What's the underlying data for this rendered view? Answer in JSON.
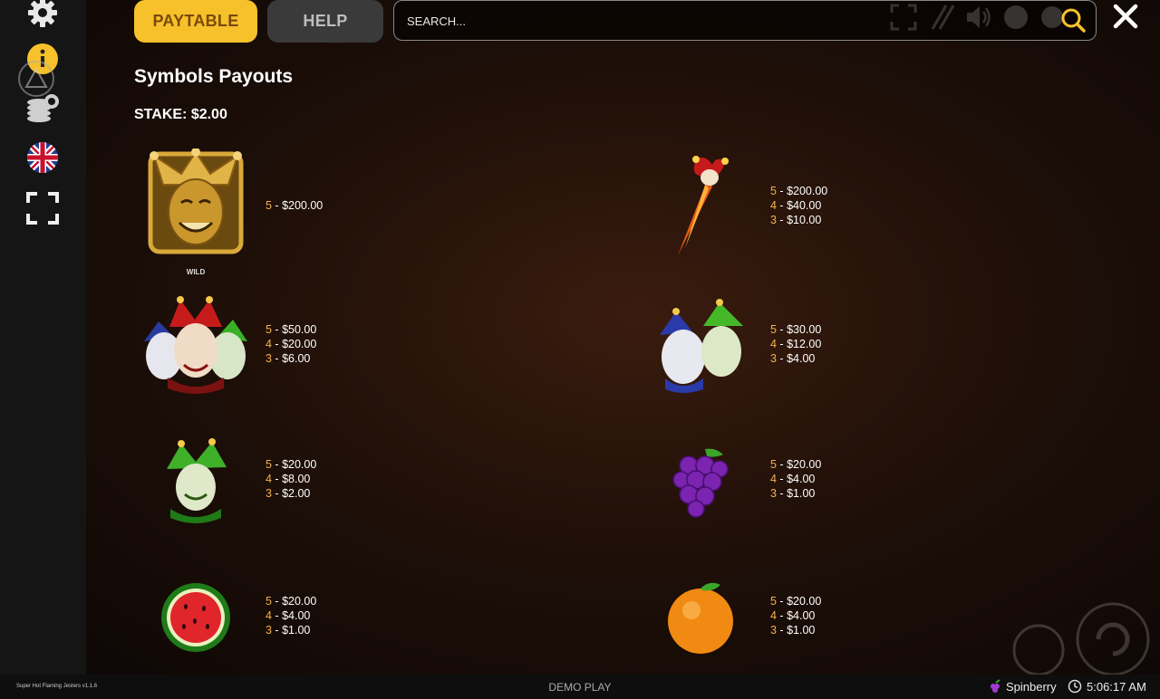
{
  "tabs": {
    "paytable": "PAYTABLE",
    "help": "HELP"
  },
  "search": {
    "placeholder": "SEARCH..."
  },
  "heading": "Symbols Payouts",
  "stake": "STAKE: $2.00",
  "sidebar_icons": [
    "gear-icon",
    "info-icon",
    "coins-icon",
    "uk-flag-icon",
    "fullscreen-icon"
  ],
  "symbols": [
    {
      "name": "wild-jester-gold",
      "label": "WILD",
      "pays": [
        {
          "n": "5",
          "v": "$200.00"
        }
      ]
    },
    {
      "name": "flaming-scepter",
      "pays": [
        {
          "n": "5",
          "v": "$200.00"
        },
        {
          "n": "4",
          "v": "$40.00"
        },
        {
          "n": "3",
          "v": "$10.00"
        }
      ]
    },
    {
      "name": "three-jesters",
      "pays": [
        {
          "n": "5",
          "v": "$50.00"
        },
        {
          "n": "4",
          "v": "$20.00"
        },
        {
          "n": "3",
          "v": "$6.00"
        }
      ]
    },
    {
      "name": "two-jesters",
      "pays": [
        {
          "n": "5",
          "v": "$30.00"
        },
        {
          "n": "4",
          "v": "$12.00"
        },
        {
          "n": "3",
          "v": "$4.00"
        }
      ]
    },
    {
      "name": "green-jester",
      "pays": [
        {
          "n": "5",
          "v": "$20.00"
        },
        {
          "n": "4",
          "v": "$8.00"
        },
        {
          "n": "3",
          "v": "$2.00"
        }
      ]
    },
    {
      "name": "grapes",
      "pays": [
        {
          "n": "5",
          "v": "$20.00"
        },
        {
          "n": "4",
          "v": "$4.00"
        },
        {
          "n": "3",
          "v": "$1.00"
        }
      ]
    },
    {
      "name": "watermelon",
      "pays": [
        {
          "n": "5",
          "v": "$20.00"
        },
        {
          "n": "4",
          "v": "$4.00"
        },
        {
          "n": "3",
          "v": "$1.00"
        }
      ]
    },
    {
      "name": "orange",
      "pays": [
        {
          "n": "5",
          "v": "$20.00"
        },
        {
          "n": "4",
          "v": "$4.00"
        },
        {
          "n": "3",
          "v": "$1.00"
        }
      ]
    }
  ],
  "footer": {
    "version": "Super Hot Flaming Jesters v1.1.6",
    "demo": "DEMO PLAY",
    "brand": "Spinberry",
    "time": "5:06:17 AM"
  },
  "colors": {
    "accent": "#f6c12a",
    "multiplier": "#f4b24a",
    "sidebar": "#151515"
  }
}
